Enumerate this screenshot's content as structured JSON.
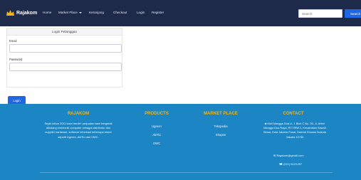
{
  "brand": {
    "name": "Rajakom"
  },
  "nav": {
    "home": "Home",
    "marketplace": "Market Place",
    "keranjang": "Keranjang",
    "checkout": "Checkout",
    "login": "Login",
    "register": "Register"
  },
  "search": {
    "placeholder": "Search",
    "button": "Search"
  },
  "login_card": {
    "title": "Login Pelanggan",
    "email_label": "Email",
    "email_value": "",
    "password_label": "Password",
    "password_value": "",
    "submit": "Login"
  },
  "footer": {
    "rajakom": {
      "title": "RAJAKOM",
      "text": "Sejak tahun 2011 kami berdiri. perjualan kami bergerak dibidang elektronik computer sebagai distributor dan supplier hardware, software informasi beberapa brand seperti Ugreen, AkiTio dan OWC."
    },
    "products": {
      "title": "PRODUCTS",
      "items": [
        "Ugreen",
        "AkiTio",
        "OWC"
      ]
    },
    "marketplace": {
      "title": "MARKET PLACE",
      "items": [
        "Tokopedia",
        "Shopee"
      ]
    },
    "contact": {
      "title": "CONTACT",
      "address": "Mall Mangga Dua Lt. 1 Blok C No. 26, Jl. Arteri Mangga Dua Raya, RT.7/RW.1, Kecamatan Sawah Besar, Kota Jakarta Pusat, Daerah Khusus Ibukota Jakarta 10730",
      "email": "Rajakom@gmail.com",
      "phone": "(021) 6121297"
    }
  },
  "colors": {
    "navbar": "#1e2a4a",
    "footer": "#1c86c5",
    "accent": "#f0b319",
    "primary_button": "#1f66e5"
  }
}
